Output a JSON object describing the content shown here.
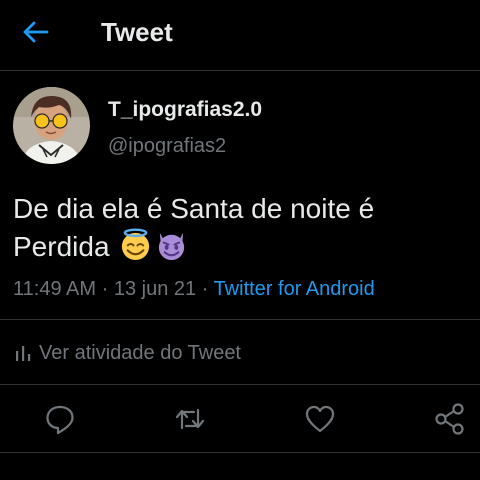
{
  "header": {
    "title": "Tweet",
    "back_icon": "arrow-left-icon",
    "accent": "#1d9bf0"
  },
  "author": {
    "display_name": "T_ipografias2.0",
    "handle": "@ipografias2",
    "avatar_icon": "avatar-image"
  },
  "tweet": {
    "text_line1": "De dia ela é Santa de noite é",
    "text_line2": "Perdida",
    "emojis": [
      "smiling-face-with-halo-icon",
      "smiling-face-with-horns-icon"
    ],
    "time": "11:49 AM",
    "separator1": "·",
    "date": "13 jun 21",
    "separator2": "·",
    "source": "Twitter for Android"
  },
  "activity": {
    "label": "Ver atividade do Tweet",
    "icon": "bar-chart-icon"
  },
  "actions": [
    {
      "name": "reply",
      "icon": "reply-icon"
    },
    {
      "name": "retweet",
      "icon": "retweet-icon"
    },
    {
      "name": "like",
      "icon": "heart-icon"
    },
    {
      "name": "share",
      "icon": "share-icon"
    }
  ],
  "colors": {
    "background": "#000000",
    "text": "#e7e9ea",
    "secondary": "#71767b",
    "link": "#1d9bf0",
    "divider": "#2f3336"
  }
}
